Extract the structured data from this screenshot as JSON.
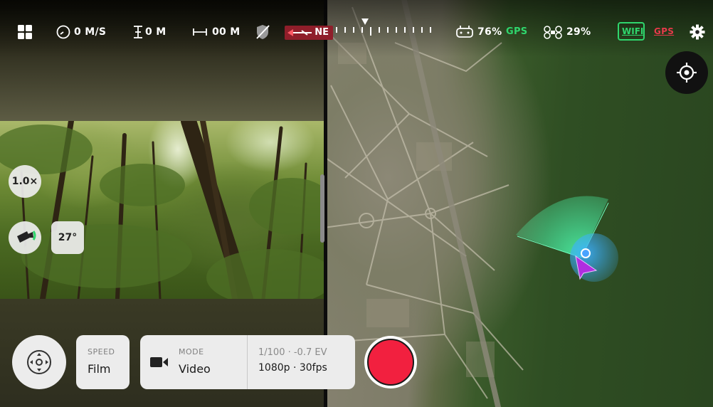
{
  "status_bar": {
    "speed": "0 M/S",
    "altitude": "0 M",
    "distance": "00 M",
    "compass_heading": "NE",
    "controller_battery": "76%",
    "controller_gps": "GPS",
    "drone_battery": "29%",
    "wifi_label": "WIFI",
    "gps_badge": "GPS"
  },
  "camera": {
    "zoom": "1.0×",
    "tilt": "27°"
  },
  "controls": {
    "speed_label": "SPEED",
    "speed_value": "Film",
    "mode_label": "MODE",
    "mode_value": "Video",
    "exposure": "1/100 · -0.7 EV",
    "resolution": "1080p · 30fps"
  },
  "colors": {
    "record": "#f2203f",
    "ok_green": "#2fd66d",
    "alert_red": "#e63a4a",
    "compass_red": "#8f1e2a",
    "drone_marker": "#b02ee0"
  },
  "icons": [
    "grid-icon",
    "speedometer-icon",
    "altitude-icon",
    "distance-icon",
    "obstacle-shield-icon",
    "controller-icon",
    "drone-icon",
    "settings-gear-icon",
    "locate-icon",
    "gimbal-icon",
    "video-camera-icon",
    "joystick-icon"
  ]
}
